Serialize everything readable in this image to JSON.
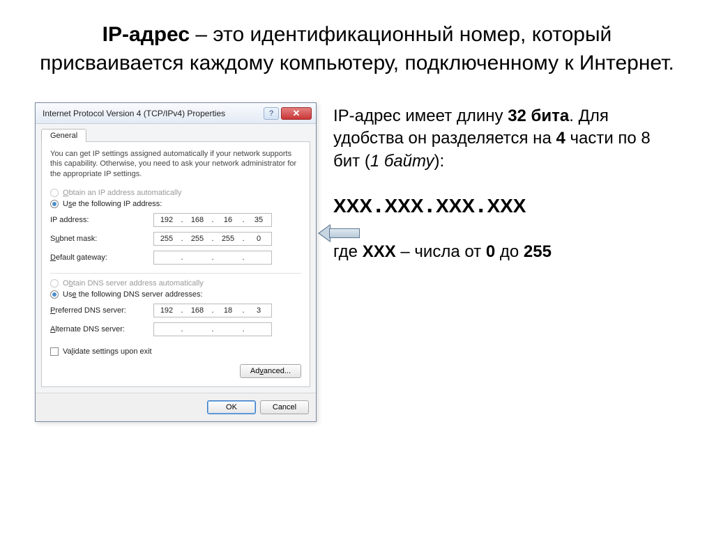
{
  "slide": {
    "title_prefix": "IP-адрес",
    "title_rest": " – это идентификационный номер, который присваивается каждому компьютеру, подключенному к Интернет."
  },
  "dialog": {
    "title": "Internet Protocol Version 4 (TCP/IPv4) Properties",
    "help": "?",
    "close": "✕",
    "tab": "General",
    "intro": "You can get IP settings assigned automatically if your network supports this capability. Otherwise, you need to ask your network administrator for the appropriate IP settings.",
    "radio_auto_ip": "Obtain an IP address automatically",
    "radio_static_ip": "Use the following IP address:",
    "labels": {
      "ip": "IP address:",
      "subnet": "Subnet mask:",
      "gateway": "Default gateway:",
      "pref_dns": "Preferred DNS server:",
      "alt_dns": "Alternate DNS server:"
    },
    "values": {
      "ip": [
        "192",
        "168",
        "16",
        "35"
      ],
      "subnet": [
        "255",
        "255",
        "255",
        "0"
      ],
      "gateway": [
        "",
        "",
        "",
        ""
      ],
      "pref_dns": [
        "192",
        "168",
        "18",
        "3"
      ],
      "alt_dns": [
        "",
        "",
        "",
        ""
      ]
    },
    "radio_auto_dns": "Obtain DNS server address automatically",
    "radio_static_dns": "Use the following DNS server addresses:",
    "validate": "Validate settings upon exit",
    "advanced": "Advanced...",
    "ok": "OK",
    "cancel": "Cancel"
  },
  "explain": {
    "line1_a": "IP-адрес имеет длину ",
    "line1_b": "32 бита",
    "line1_c": ". Для удобства он разделяется на ",
    "line1_d": "4",
    "line1_e": " части по 8 бит (",
    "line1_f": "1 байту",
    "line1_g": "):",
    "x": "ХХХ",
    "dot": ".",
    "line3_a": "где ",
    "line3_b": "ХХХ",
    "line3_c": " – числа от ",
    "line3_d": "0",
    "line3_e": " до ",
    "line3_f": "255"
  }
}
